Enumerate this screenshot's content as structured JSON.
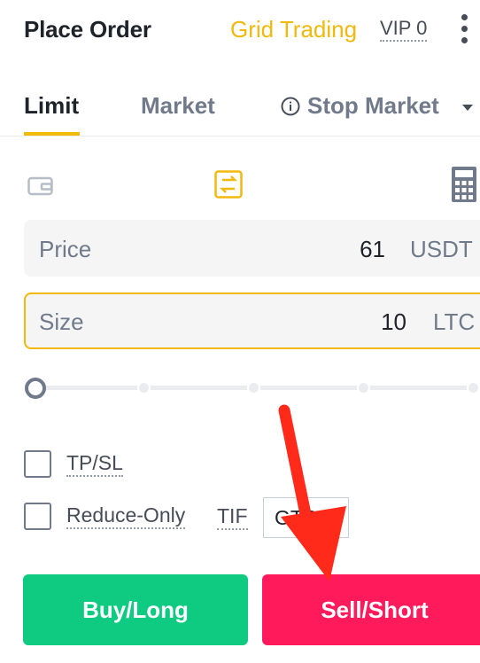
{
  "header": {
    "title": "Place Order",
    "grid_trading": "Grid Trading",
    "vip": "VIP 0",
    "menu_icon": "kebab-menu-icon"
  },
  "tabs": [
    {
      "label": "Limit",
      "active": true
    },
    {
      "label": "Market",
      "active": false
    },
    {
      "label": "Stop Market",
      "active": false,
      "icon": "info-icon",
      "dropdown": true
    }
  ],
  "tools": {
    "wallet_icon": "wallet-icon",
    "transfer_icon": "transfer-icon",
    "calculator_icon": "calculator-icon"
  },
  "price": {
    "label": "Price",
    "value": "61",
    "unit": "USDT"
  },
  "size": {
    "label": "Size",
    "value": "10",
    "unit": "LTC"
  },
  "slider": {
    "value_percent": 0,
    "marks": [
      0,
      25,
      50,
      75,
      100
    ]
  },
  "options": {
    "tpsl": {
      "label": "TP/SL",
      "checked": false
    },
    "reduce_only": {
      "label": "Reduce-Only",
      "checked": false
    },
    "tif_label": "TIF",
    "tif_value": "GTC"
  },
  "buttons": {
    "buy": "Buy/Long",
    "sell": "Sell/Short"
  },
  "colors": {
    "accent": "#f0b90b",
    "buy": "#0ecb81",
    "sell": "#ff1a5c",
    "annotation_arrow": "#ff2a1a"
  },
  "annotation": {
    "type": "arrow",
    "icon": "red-arrow-icon",
    "points_to": "sell-button"
  }
}
